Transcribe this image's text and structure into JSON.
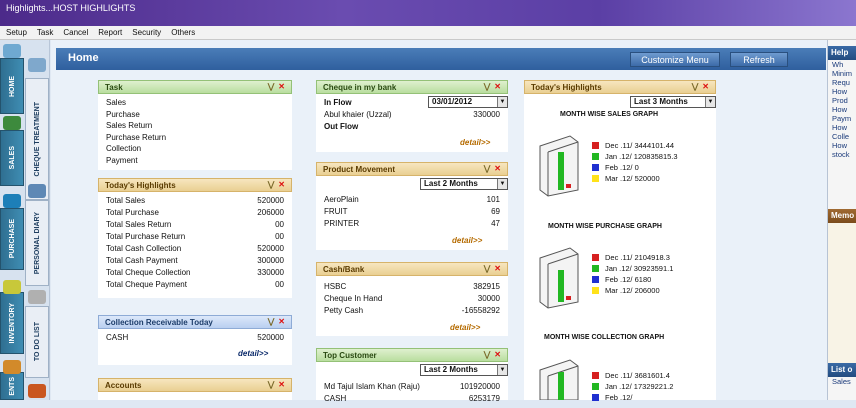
{
  "window": {
    "title": "Highlights...HOST HIGHLIGHTS"
  },
  "menu": [
    "Setup",
    "Task",
    "Cancel",
    "Report",
    "Security",
    "Others"
  ],
  "left_tabs": [
    "HOME",
    "SALES",
    "PURCHASE",
    "INVENTORY",
    "ENTS",
    "CHEQUE TREATMENT",
    "PERSONAL DIARY",
    "TO DO LIST"
  ],
  "header": {
    "title": "Home",
    "customize_label": "Customize Menu",
    "refresh_label": "Refresh"
  },
  "task_panel": {
    "title": "Task",
    "items": [
      "Sales",
      "Purchase",
      "Sales Return",
      "Purchase Return",
      "Collection",
      "Payment"
    ]
  },
  "highlights_panel": {
    "title": "Today's Highlights",
    "rows": [
      {
        "label": "Total Sales",
        "value": "520000"
      },
      {
        "label": "Total Purchase",
        "value": "206000"
      },
      {
        "label": "Total Sales Return",
        "value": "00"
      },
      {
        "label": "Total Purchase Return",
        "value": "00"
      },
      {
        "label": "Total Cash Collection",
        "value": "520000"
      },
      {
        "label": "Total Cash Payment",
        "value": "300000"
      },
      {
        "label": "Total Cheque Collection",
        "value": "330000"
      },
      {
        "label": "Total Cheque Payment",
        "value": "00"
      }
    ]
  },
  "collection_panel": {
    "title": "Collection Receivable Today",
    "rows": [
      {
        "label": "CASH",
        "value": "520000"
      }
    ],
    "detail_label": "detail>>"
  },
  "accounts_panel": {
    "title": "Accounts"
  },
  "cheque_panel": {
    "title": "Cheque in my bank",
    "in_flow_label": "In Flow",
    "date_value": "03/01/2012",
    "rows": [
      {
        "label": "Abul khaier (Uzzal)",
        "value": "330000"
      }
    ],
    "out_flow_label": "Out Flow",
    "detail_label": "detail>>"
  },
  "product_panel": {
    "title": "Product Movement",
    "period": "Last 2 Months",
    "rows": [
      {
        "label": "AeroPlain",
        "value": "101"
      },
      {
        "label": "FRUIT",
        "value": "69"
      },
      {
        "label": "PRINTER",
        "value": "47"
      }
    ],
    "detail_label": "detail>>"
  },
  "cashbank_panel": {
    "title": "Cash/Bank",
    "rows": [
      {
        "label": "HSBC",
        "value": "382915"
      },
      {
        "label": "Cheque In Hand",
        "value": "30000"
      },
      {
        "label": "Petty Cash",
        "value": "-16558292"
      }
    ],
    "detail_label": "detail>>"
  },
  "customer_panel": {
    "title": "Top Customer",
    "period": "Last 2 Months",
    "rows": [
      {
        "label": "Md Tajul Islam Khan (Raju)",
        "value": "101920000"
      },
      {
        "label": "CASH",
        "value": "6253179"
      }
    ]
  },
  "graphs_panel": {
    "title": "Today's Highlights",
    "period": "Last 3 Months",
    "graphs": [
      {
        "title": "MONTH WISE SALES GRAPH",
        "legend": [
          "Dec .11/ 3444101.44",
          "Jan .12/ 120835815.3",
          "Feb .12/ 0",
          "Mar .12/ 520000"
        ]
      },
      {
        "title": "MONTH WISE PURCHASE GRAPH",
        "legend": [
          "Dec .11/ 2104918.3",
          "Jan .12/ 30923591.1",
          "Feb .12/ 6180",
          "Mar .12/ 206000"
        ]
      },
      {
        "title": "MONTH WISE COLLECTION GRAPH",
        "legend": [
          "Dec .11/ 3681601.4",
          "Jan .12/ 17329221.2",
          "Feb .12/"
        ]
      }
    ],
    "legend_colors": [
      "#d62020",
      "#22b822",
      "#1f2fd0",
      "#ffe21a"
    ]
  },
  "right_panel": {
    "help_title": "Help",
    "help_links": [
      "Wh",
      "Minim",
      "Requ",
      "How",
      "Prod",
      "How",
      "Paym",
      "How",
      "Colle",
      "How",
      "stock"
    ],
    "memo_title": "Memo",
    "list_title": "List o",
    "list_sub": "Sales"
  }
}
